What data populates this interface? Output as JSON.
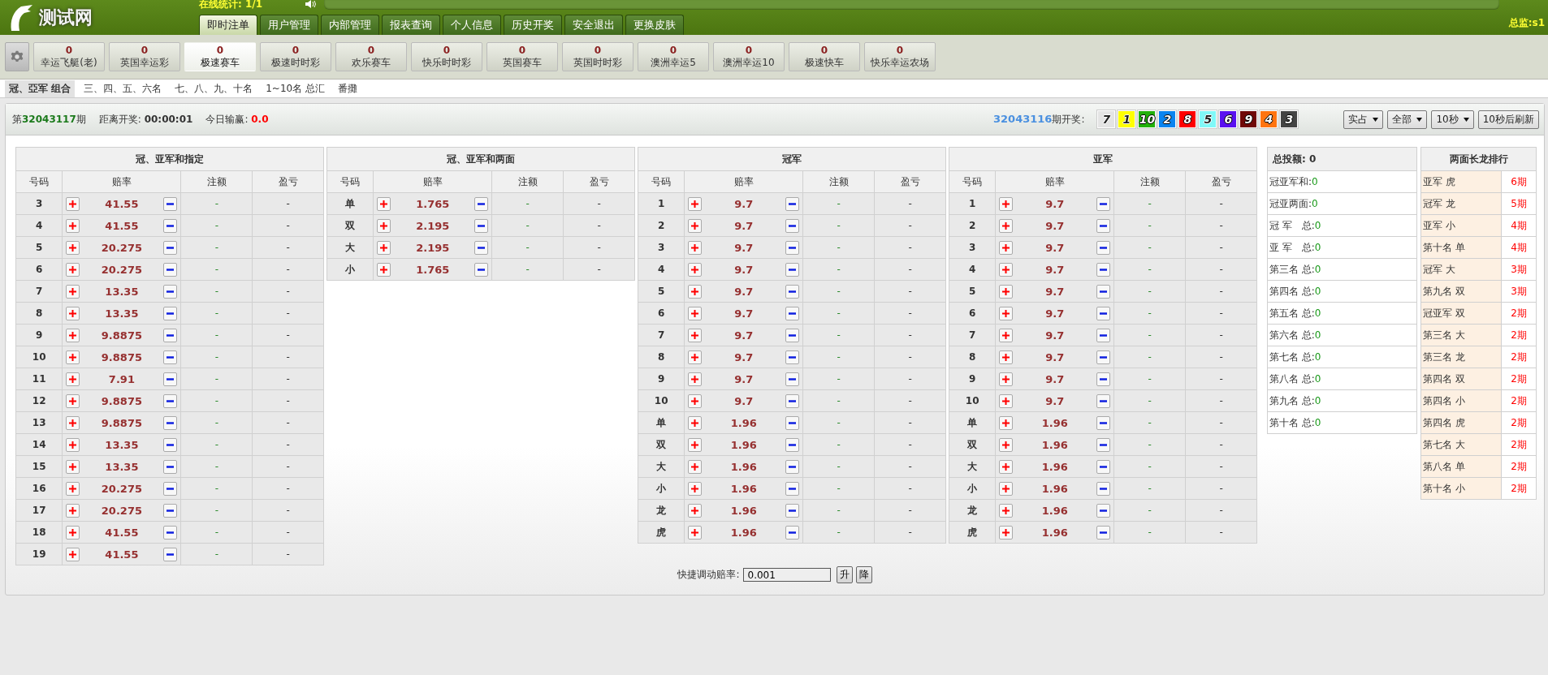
{
  "header": {
    "logo": "测试网",
    "online": "在线统计: 1/1",
    "user": "总监:s1"
  },
  "nav_tabs": [
    {
      "label": "即时注单",
      "selected": true
    },
    {
      "label": "用户管理",
      "selected": false
    },
    {
      "label": "内部管理",
      "selected": false
    },
    {
      "label": "报表查询",
      "selected": false
    },
    {
      "label": "个人信息",
      "selected": false
    },
    {
      "label": "历史开奖",
      "selected": false
    },
    {
      "label": "安全退出",
      "selected": false
    },
    {
      "label": "更换皮肤",
      "selected": false
    }
  ],
  "games": [
    {
      "count": "0",
      "label": "幸运飞艇(老)",
      "selected": false
    },
    {
      "count": "0",
      "label": "英国幸运彩",
      "selected": false
    },
    {
      "count": "0",
      "label": "极速赛车",
      "selected": true
    },
    {
      "count": "0",
      "label": "极速时时彩",
      "selected": false
    },
    {
      "count": "0",
      "label": "欢乐赛车",
      "selected": false
    },
    {
      "count": "0",
      "label": "快乐时时彩",
      "selected": false
    },
    {
      "count": "0",
      "label": "英国赛车",
      "selected": false
    },
    {
      "count": "0",
      "label": "英国时时彩",
      "selected": false
    },
    {
      "count": "0",
      "label": "澳洲幸运5",
      "selected": false
    },
    {
      "count": "0",
      "label": "澳洲幸运10",
      "selected": false
    },
    {
      "count": "0",
      "label": "极速快车",
      "selected": false
    },
    {
      "count": "0",
      "label": "快乐幸运农场",
      "selected": false
    }
  ],
  "sub_tabs": [
    {
      "label": "冠、亞军 组合",
      "selected": true
    },
    {
      "label": "三、四、五、六名",
      "selected": false
    },
    {
      "label": "七、八、九、十名",
      "selected": false
    },
    {
      "label": "1~10名 总汇",
      "selected": false
    },
    {
      "label": "番攤",
      "selected": false
    }
  ],
  "info": {
    "period_prefix": "第",
    "period": "32043117",
    "period_suffix": "期",
    "countdown_label": "距离开奖:",
    "countdown": "00:00:01",
    "profit_label": "今日输赢:",
    "profit": "0.0",
    "last_period": "32043116",
    "last_label": "期开奖:",
    "balls": [
      {
        "number": "7",
        "color": "#e4e4e4"
      },
      {
        "number": "1",
        "color": "#ffff00"
      },
      {
        "number": "10",
        "color": "#22b10a"
      },
      {
        "number": "2",
        "color": "#0a84f0"
      },
      {
        "number": "8",
        "color": "#ff0000"
      },
      {
        "number": "5",
        "color": "#80f8f8"
      },
      {
        "number": "6",
        "color": "#5a10f0"
      },
      {
        "number": "9",
        "color": "#700808"
      },
      {
        "number": "4",
        "color": "#ff7410"
      },
      {
        "number": "3",
        "color": "#444444"
      }
    ]
  },
  "controls": [
    {
      "kind": "dropdown",
      "label": "实占"
    },
    {
      "kind": "dropdown",
      "label": "全部"
    },
    {
      "kind": "dropdown",
      "label": "10秒"
    },
    {
      "kind": "button",
      "label": "10秒后刷新"
    }
  ],
  "tables": [
    {
      "title": "冠、亚军和指定",
      "columns": [
        "号码",
        "赔率",
        "注额",
        "盈亏"
      ],
      "rows": [
        {
          "code": "3",
          "odds": "41.55",
          "amount": "-",
          "profit": "-"
        },
        {
          "code": "4",
          "odds": "41.55",
          "amount": "-",
          "profit": "-"
        },
        {
          "code": "5",
          "odds": "20.275",
          "amount": "-",
          "profit": "-"
        },
        {
          "code": "6",
          "odds": "20.275",
          "amount": "-",
          "profit": "-"
        },
        {
          "code": "7",
          "odds": "13.35",
          "amount": "-",
          "profit": "-"
        },
        {
          "code": "8",
          "odds": "13.35",
          "amount": "-",
          "profit": "-"
        },
        {
          "code": "9",
          "odds": "9.8875",
          "amount": "-",
          "profit": "-"
        },
        {
          "code": "10",
          "odds": "9.8875",
          "amount": "-",
          "profit": "-"
        },
        {
          "code": "11",
          "odds": "7.91",
          "amount": "-",
          "profit": "-"
        },
        {
          "code": "12",
          "odds": "9.8875",
          "amount": "-",
          "profit": "-"
        },
        {
          "code": "13",
          "odds": "9.8875",
          "amount": "-",
          "profit": "-"
        },
        {
          "code": "14",
          "odds": "13.35",
          "amount": "-",
          "profit": "-"
        },
        {
          "code": "15",
          "odds": "13.35",
          "amount": "-",
          "profit": "-"
        },
        {
          "code": "16",
          "odds": "20.275",
          "amount": "-",
          "profit": "-"
        },
        {
          "code": "17",
          "odds": "20.275",
          "amount": "-",
          "profit": "-"
        },
        {
          "code": "18",
          "odds": "41.55",
          "amount": "-",
          "profit": "-"
        },
        {
          "code": "19",
          "odds": "41.55",
          "amount": "-",
          "profit": "-"
        }
      ]
    },
    {
      "title": "冠、亚军和两面",
      "columns": [
        "号码",
        "赔率",
        "注额",
        "盈亏"
      ],
      "rows": [
        {
          "code": "单",
          "odds": "1.765",
          "amount": "-",
          "profit": "-"
        },
        {
          "code": "双",
          "odds": "2.195",
          "amount": "-",
          "profit": "-"
        },
        {
          "code": "大",
          "odds": "2.195",
          "amount": "-",
          "profit": "-"
        },
        {
          "code": "小",
          "odds": "1.765",
          "amount": "-",
          "profit": "-"
        }
      ]
    },
    {
      "title": "冠军",
      "columns": [
        "号码",
        "赔率",
        "注额",
        "盈亏"
      ],
      "rows": [
        {
          "code": "1",
          "odds": "9.7",
          "amount": "-",
          "profit": "-"
        },
        {
          "code": "2",
          "odds": "9.7",
          "amount": "-",
          "profit": "-"
        },
        {
          "code": "3",
          "odds": "9.7",
          "amount": "-",
          "profit": "-"
        },
        {
          "code": "4",
          "odds": "9.7",
          "amount": "-",
          "profit": "-"
        },
        {
          "code": "5",
          "odds": "9.7",
          "amount": "-",
          "profit": "-"
        },
        {
          "code": "6",
          "odds": "9.7",
          "amount": "-",
          "profit": "-"
        },
        {
          "code": "7",
          "odds": "9.7",
          "amount": "-",
          "profit": "-"
        },
        {
          "code": "8",
          "odds": "9.7",
          "amount": "-",
          "profit": "-"
        },
        {
          "code": "9",
          "odds": "9.7",
          "amount": "-",
          "profit": "-"
        },
        {
          "code": "10",
          "odds": "9.7",
          "amount": "-",
          "profit": "-"
        },
        {
          "code": "单",
          "odds": "1.96",
          "amount": "-",
          "profit": "-"
        },
        {
          "code": "双",
          "odds": "1.96",
          "amount": "-",
          "profit": "-"
        },
        {
          "code": "大",
          "odds": "1.96",
          "amount": "-",
          "profit": "-"
        },
        {
          "code": "小",
          "odds": "1.96",
          "amount": "-",
          "profit": "-"
        },
        {
          "code": "龙",
          "odds": "1.96",
          "amount": "-",
          "profit": "-"
        },
        {
          "code": "虎",
          "odds": "1.96",
          "amount": "-",
          "profit": "-"
        }
      ]
    },
    {
      "title": "亚军",
      "columns": [
        "号码",
        "赔率",
        "注额",
        "盈亏"
      ],
      "rows": [
        {
          "code": "1",
          "odds": "9.7",
          "amount": "-",
          "profit": "-"
        },
        {
          "code": "2",
          "odds": "9.7",
          "amount": "-",
          "profit": "-"
        },
        {
          "code": "3",
          "odds": "9.7",
          "amount": "-",
          "profit": "-"
        },
        {
          "code": "4",
          "odds": "9.7",
          "amount": "-",
          "profit": "-"
        },
        {
          "code": "5",
          "odds": "9.7",
          "amount": "-",
          "profit": "-"
        },
        {
          "code": "6",
          "odds": "9.7",
          "amount": "-",
          "profit": "-"
        },
        {
          "code": "7",
          "odds": "9.7",
          "amount": "-",
          "profit": "-"
        },
        {
          "code": "8",
          "odds": "9.7",
          "amount": "-",
          "profit": "-"
        },
        {
          "code": "9",
          "odds": "9.7",
          "amount": "-",
          "profit": "-"
        },
        {
          "code": "10",
          "odds": "9.7",
          "amount": "-",
          "profit": "-"
        },
        {
          "code": "单",
          "odds": "1.96",
          "amount": "-",
          "profit": "-"
        },
        {
          "code": "双",
          "odds": "1.96",
          "amount": "-",
          "profit": "-"
        },
        {
          "code": "大",
          "odds": "1.96",
          "amount": "-",
          "profit": "-"
        },
        {
          "code": "小",
          "odds": "1.96",
          "amount": "-",
          "profit": "-"
        },
        {
          "code": "龙",
          "odds": "1.96",
          "amount": "-",
          "profit": "-"
        },
        {
          "code": "虎",
          "odds": "1.96",
          "amount": "-",
          "profit": "-"
        }
      ]
    }
  ],
  "totals": {
    "label": "总投额:",
    "value": "0",
    "rows": [
      {
        "label": "冠亚军和:",
        "value": "0"
      },
      {
        "label": "冠亚两面:",
        "value": "0"
      },
      {
        "label": "冠 军　总:",
        "value": "0"
      },
      {
        "label": "亚 军　总:",
        "value": "0"
      },
      {
        "label": "第三名 总:",
        "value": "0"
      },
      {
        "label": "第四名 总:",
        "value": "0"
      },
      {
        "label": "第五名 总:",
        "value": "0"
      },
      {
        "label": "第六名 总:",
        "value": "0"
      },
      {
        "label": "第七名 总:",
        "value": "0"
      },
      {
        "label": "第八名 总:",
        "value": "0"
      },
      {
        "label": "第九名 总:",
        "value": "0"
      },
      {
        "label": "第十名 总:",
        "value": "0"
      }
    ]
  },
  "ranking": {
    "title": "两面长龙排行",
    "rows": [
      {
        "label": "亚军 虎",
        "value": "6期"
      },
      {
        "label": "冠军 龙",
        "value": "5期"
      },
      {
        "label": "亚军 小",
        "value": "4期"
      },
      {
        "label": "第十名 单",
        "value": "4期"
      },
      {
        "label": "冠军 大",
        "value": "3期"
      },
      {
        "label": "第九名 双",
        "value": "3期"
      },
      {
        "label": "冠亚军 双",
        "value": "2期"
      },
      {
        "label": "第三名 大",
        "value": "2期"
      },
      {
        "label": "第三名 龙",
        "value": "2期"
      },
      {
        "label": "第四名 双",
        "value": "2期"
      },
      {
        "label": "第四名 小",
        "value": "2期"
      },
      {
        "label": "第四名 虎",
        "value": "2期"
      },
      {
        "label": "第七名 大",
        "value": "2期"
      },
      {
        "label": "第八名 单",
        "value": "2期"
      },
      {
        "label": "第十名 小",
        "value": "2期"
      }
    ]
  },
  "quick_adjust": {
    "label": "快捷调动赔率:",
    "value": "0.001",
    "buttons": [
      "升",
      "降"
    ]
  }
}
